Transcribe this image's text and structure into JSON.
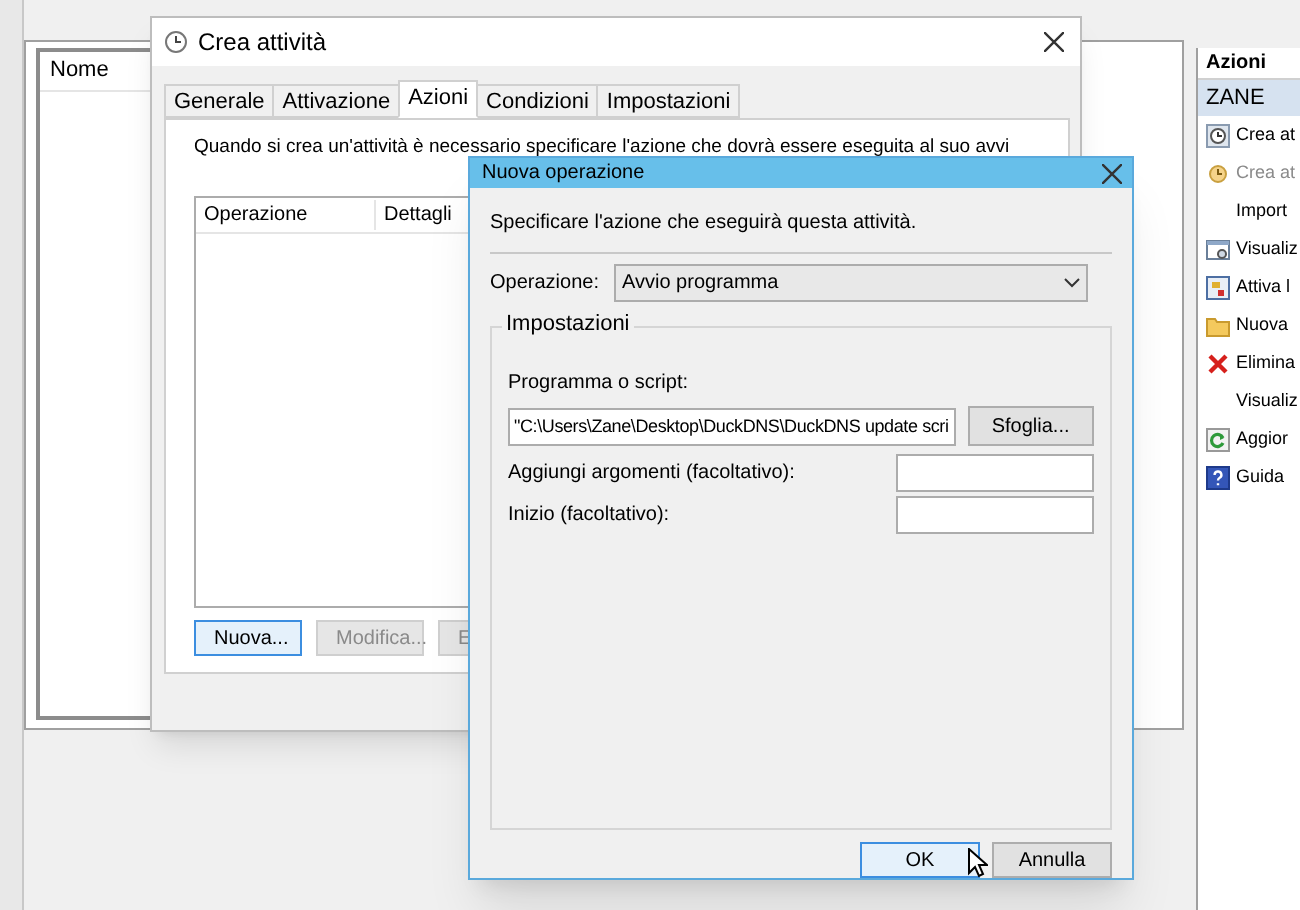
{
  "main_list": {
    "columns": [
      "Nome"
    ]
  },
  "actions_pane": {
    "title": "Azioni",
    "section": "ZANE",
    "items": [
      {
        "label": "Crea at",
        "kind": "clock",
        "disabled": false
      },
      {
        "label": "Crea at",
        "kind": "clock-small",
        "disabled": true
      },
      {
        "label": "Import",
        "kind": "none",
        "disabled": false
      },
      {
        "label": "Visualiz",
        "kind": "view",
        "disabled": false
      },
      {
        "label": "Attiva l",
        "kind": "activate",
        "disabled": false
      },
      {
        "label": "Nuova",
        "kind": "folder",
        "disabled": false
      },
      {
        "label": "Elimina",
        "kind": "delete",
        "disabled": false
      },
      {
        "label": "Visualiz",
        "kind": "none",
        "disabled": false
      },
      {
        "label": "Aggior",
        "kind": "refresh",
        "disabled": false
      },
      {
        "label": "Guida",
        "kind": "help",
        "disabled": false
      }
    ]
  },
  "create_task": {
    "title": "Crea attività",
    "tabs": [
      {
        "label": "Generale",
        "selected": false
      },
      {
        "label": "Attivazione",
        "selected": false
      },
      {
        "label": "Azioni",
        "selected": true
      },
      {
        "label": "Condizioni",
        "selected": false
      },
      {
        "label": "Impostazioni",
        "selected": false
      }
    ],
    "description": "Quando si crea un'attività è necessario specificare l'azione che dovrà essere eseguita al suo avvi",
    "columns": [
      "Operazione",
      "Dettagli"
    ],
    "buttons": [
      {
        "label": "Nuova...",
        "disabled": false,
        "focused": true
      },
      {
        "label": "Modifica...",
        "disabled": true,
        "focused": false
      },
      {
        "label": "E",
        "disabled": true,
        "focused": false
      }
    ]
  },
  "new_action": {
    "title": "Nuova operazione",
    "instruction": "Specificare l'azione che eseguirà questa attività.",
    "operation_label": "Operazione:",
    "operation_value": "Avvio programma",
    "group_title": "Impostazioni",
    "program_label": "Programma o script:",
    "program_value": "\"C:\\Users\\Zane\\Desktop\\DuckDNS\\DuckDNS update scri",
    "browse": "Sfoglia...",
    "args_label": "Aggiungi argomenti (facoltativo):",
    "start_label": "Inizio (facoltativo):",
    "buttons": [
      {
        "label": "OK",
        "focused": true
      },
      {
        "label": "Annulla",
        "focused": false
      }
    ]
  }
}
